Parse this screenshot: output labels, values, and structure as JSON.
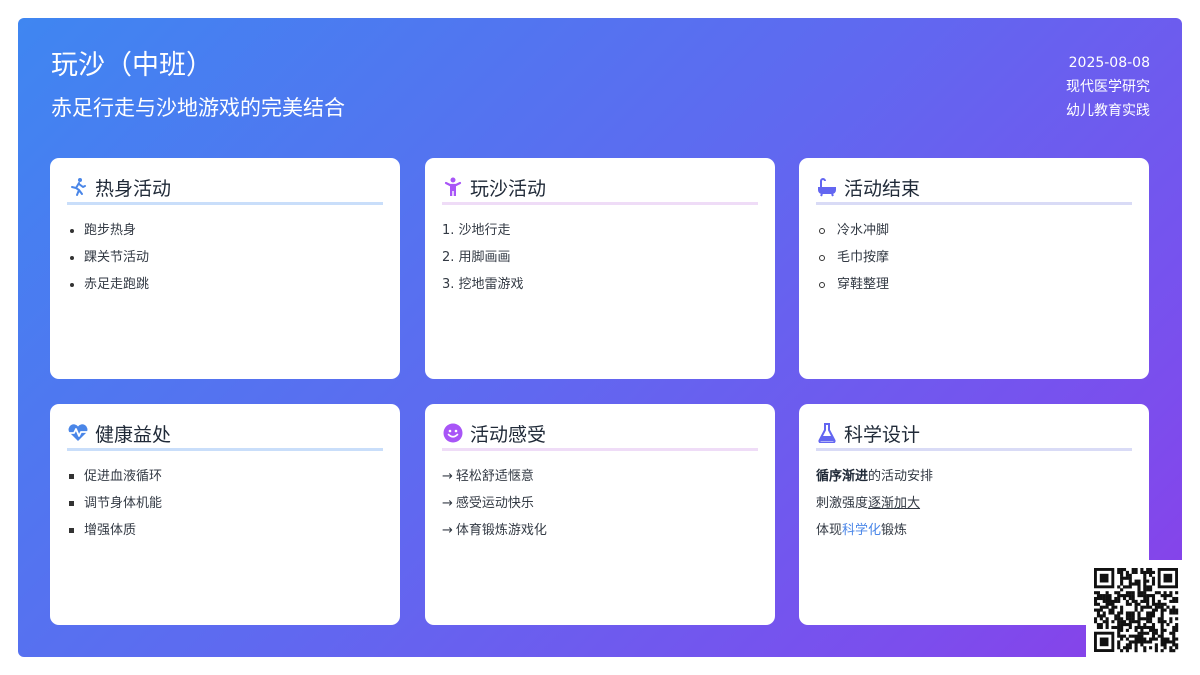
{
  "header": {
    "title": "玩沙（中班）",
    "subtitle": "赤足行走与沙地游戏的完美结合",
    "date": "2025-08-08",
    "tag1": "现代医学研究",
    "tag2": "幼儿教育实践"
  },
  "cards": [
    {
      "title": "热身活动",
      "icon": "running-icon",
      "items": [
        "跑步热身",
        "踝关节活动",
        "赤足走跑跳"
      ]
    },
    {
      "title": "玩沙活动",
      "icon": "child-icon",
      "items": [
        "1. 沙地行走",
        "2. 用脚画画",
        "3. 挖地雷游戏"
      ]
    },
    {
      "title": "活动结束",
      "icon": "bath-icon",
      "items": [
        "冷水冲脚",
        "毛巾按摩",
        "穿鞋整理"
      ]
    },
    {
      "title": "健康益处",
      "icon": "heart-pulse-icon",
      "items": [
        "促进血液循环",
        "调节身体机能",
        "增强体质"
      ]
    },
    {
      "title": "活动感受",
      "icon": "smile-icon",
      "items": [
        "轻松舒适惬意",
        "感受运动快乐",
        "体育锻炼游戏化"
      ]
    },
    {
      "title": "科学设计",
      "icon": "flask-icon",
      "line1_strong": "循序渐进",
      "line1_rest": "的活动安排",
      "line2_pre": "刺激强度",
      "line2_ul": "逐渐加大",
      "line3_pre": "体现",
      "line3_em": "科学化",
      "line3_post": "锻炼"
    }
  ],
  "colors": {
    "accent_blue": "#4a86e8",
    "accent_purple": "#8a3fe8"
  }
}
